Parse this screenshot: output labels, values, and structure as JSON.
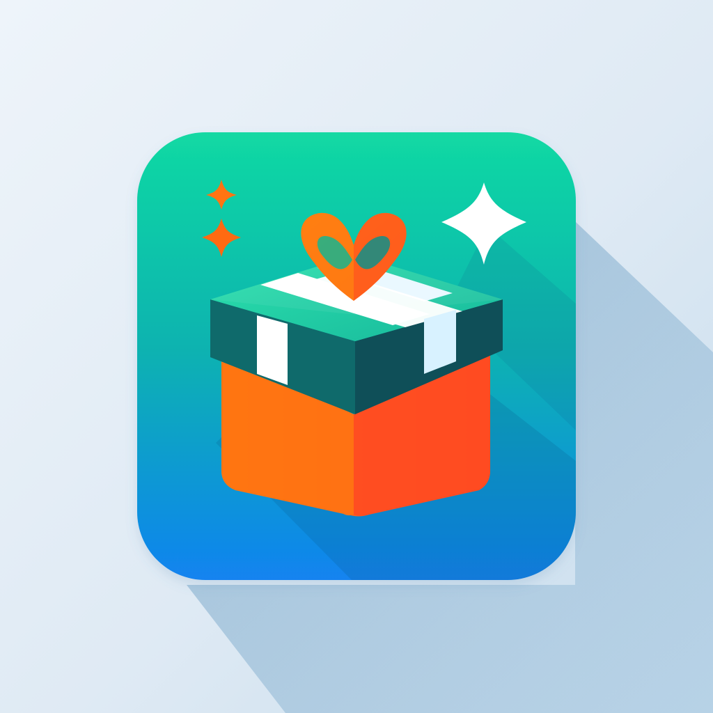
{
  "icon": {
    "semantic": "gift-box-app-icon",
    "colors": {
      "background_light": "#eef4fa",
      "background_mid": "#dfeaf4",
      "background_deep": "#c6dced",
      "tile_top": "#12d9a3",
      "tile_bottom": "#1283f0",
      "box_orange": "#ff5a1f",
      "box_orange_light": "#ff7d17",
      "box_orange_dark": "#f23b24",
      "lid_green": "#20c79a",
      "lid_green_dark": "#0f5f68",
      "lid_side_dark": "#10484f",
      "ribbon_white": "#ffffff",
      "ribbon_blue_tint": "#cfefff",
      "bow_orange": "#ff6a12",
      "sparkle_orange": "#ff6b12",
      "sparkle_white": "#ffffff"
    },
    "elements": [
      "gift-box-icon",
      "bow-icon",
      "sparkle-icon",
      "sparkle-icon",
      "sparkle-icon"
    ]
  }
}
